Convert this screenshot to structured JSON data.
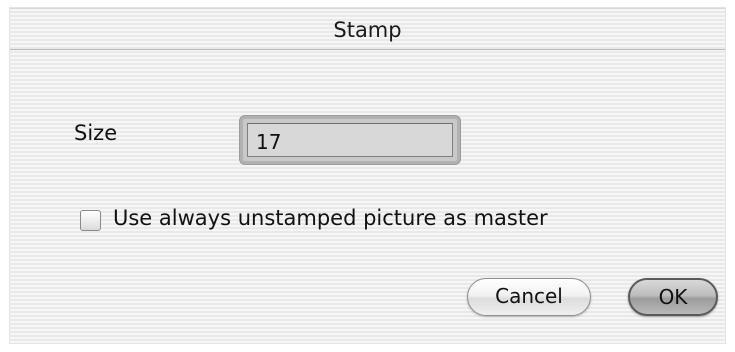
{
  "dialog": {
    "title": "Stamp",
    "size_label": "Size",
    "size_value": "17",
    "checkbox": {
      "label": "Use always unstamped picture as master",
      "checked": false
    },
    "buttons": {
      "cancel_label": "Cancel",
      "ok_label": "OK"
    }
  },
  "colors": {
    "background_stripe_light": "#f6f6f6",
    "background_stripe_dark": "#e9e9e9",
    "default_button": "#a8a8a8"
  }
}
